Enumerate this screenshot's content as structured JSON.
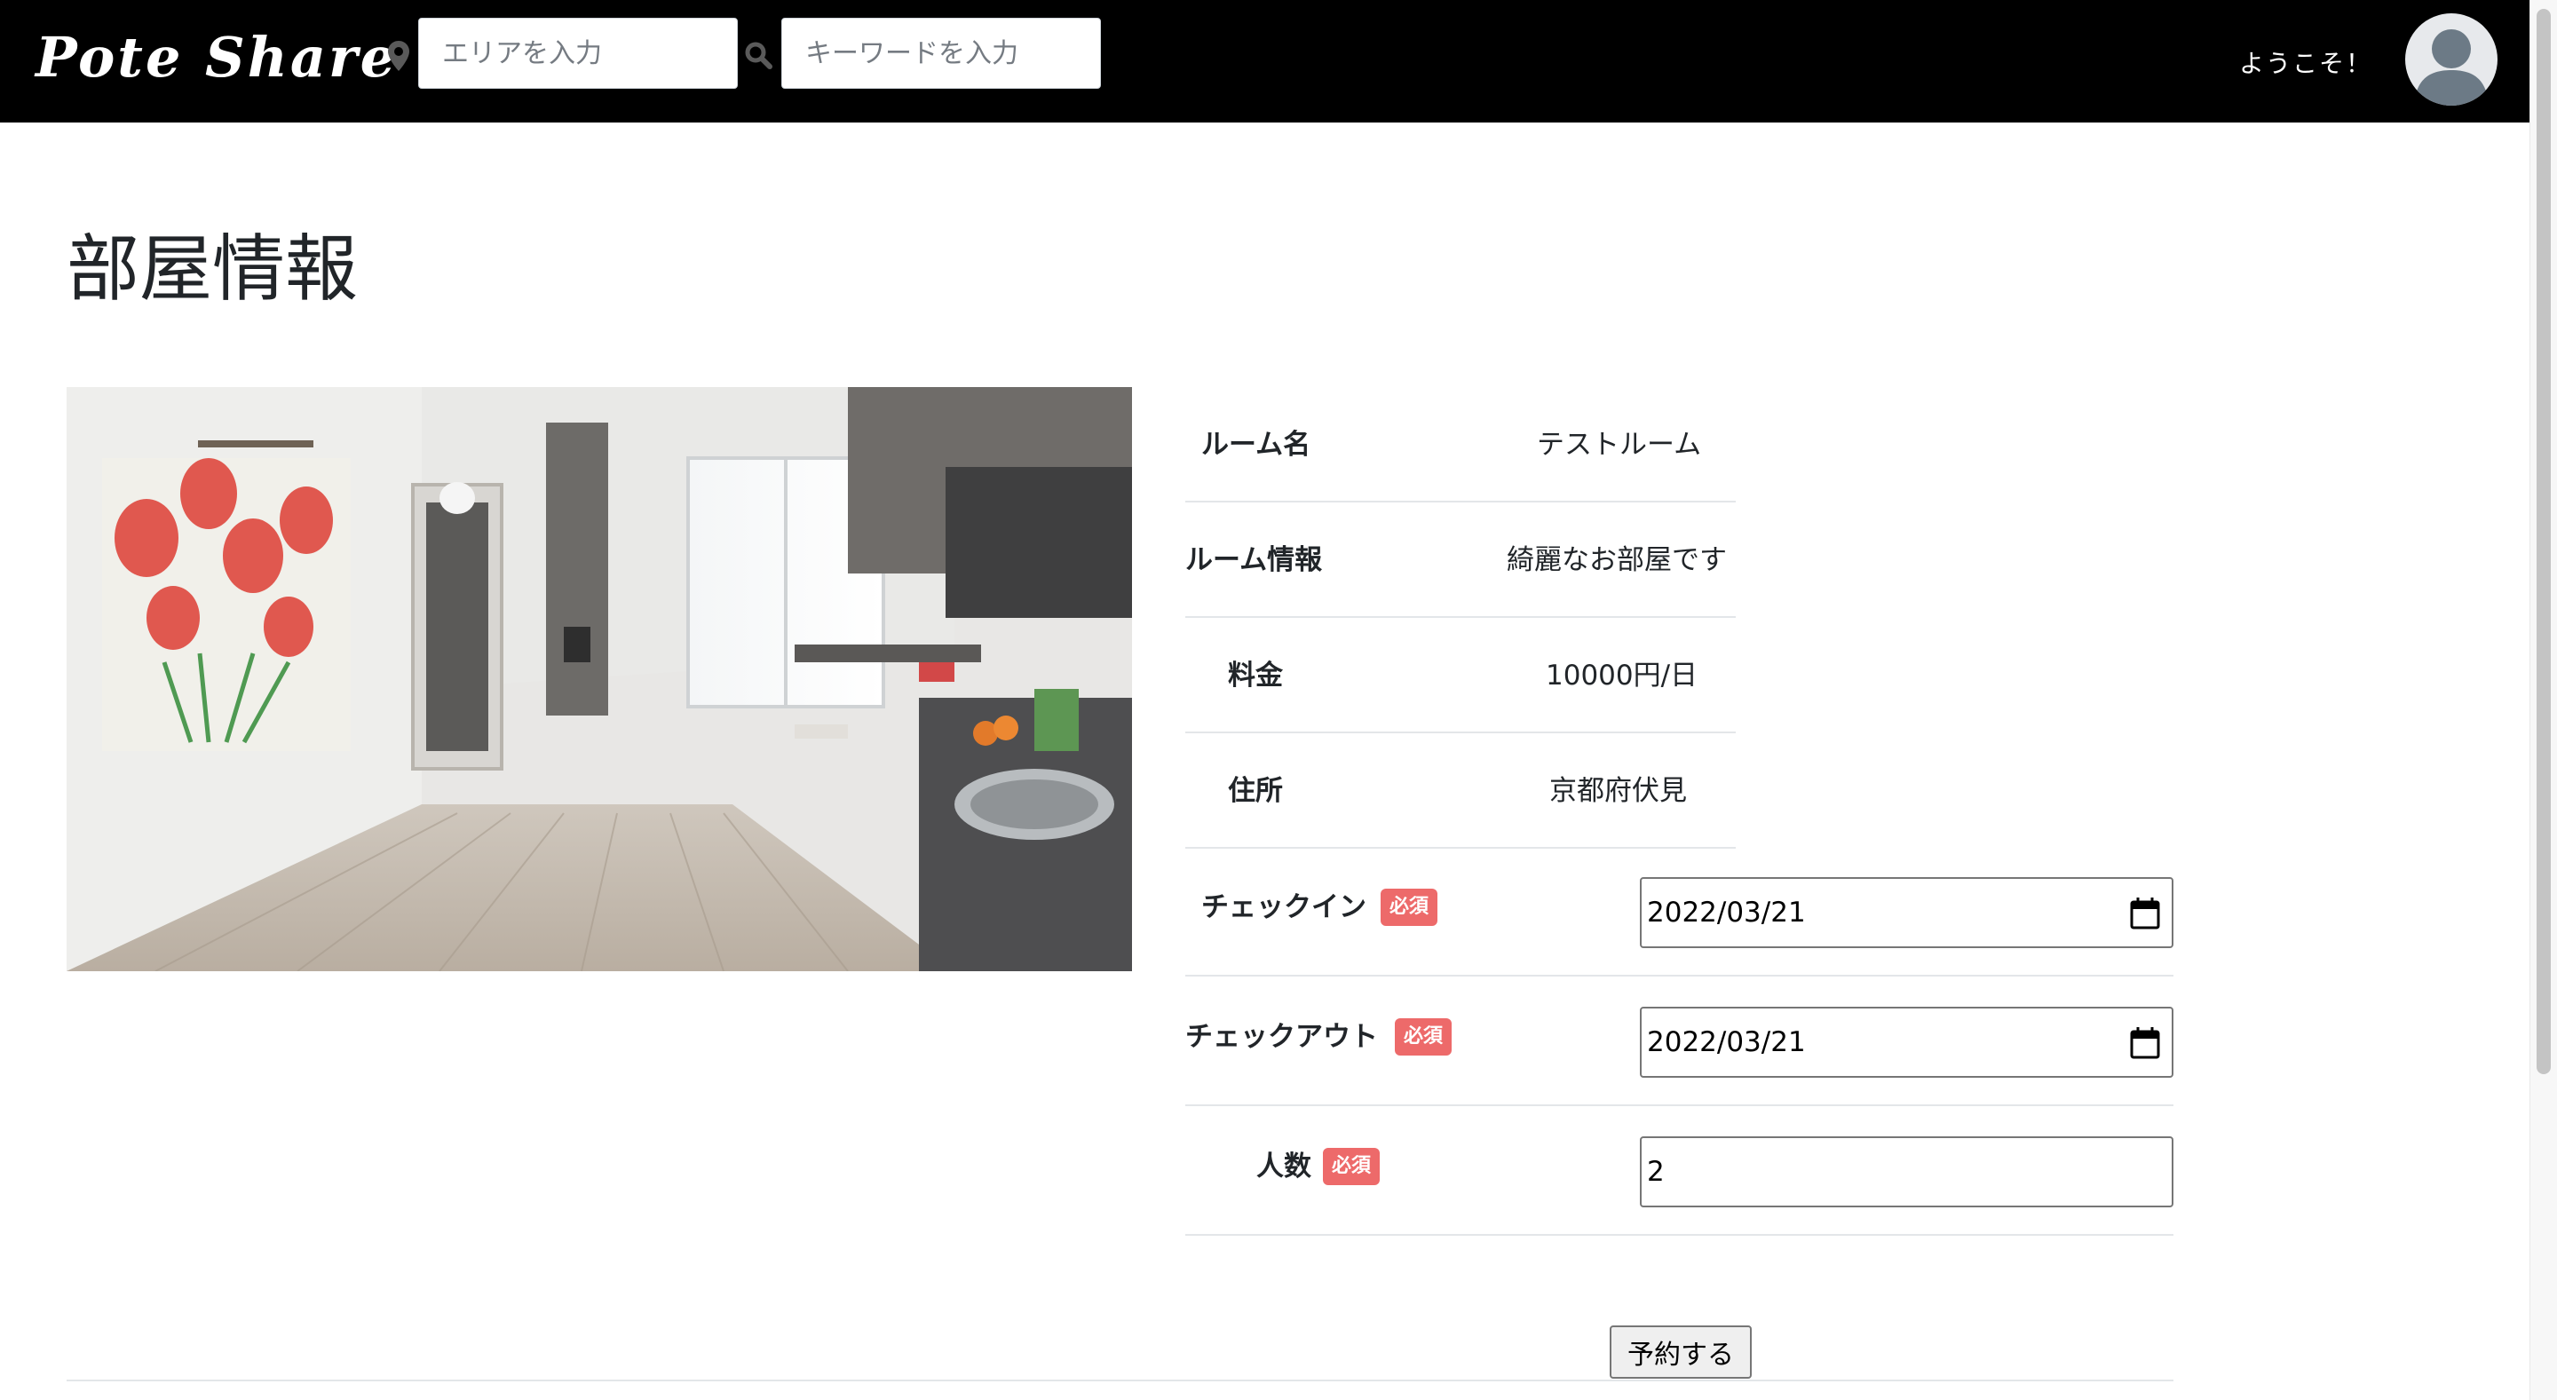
{
  "navbar": {
    "logo": "Pote Share",
    "area_placeholder": "エリアを入力",
    "keyword_placeholder": "キーワードを入力",
    "welcome": "ようこそ！",
    "icons": [
      "map-pin-icon",
      "search-icon",
      "user-avatar-icon"
    ]
  },
  "page": {
    "title": "部屋情報"
  },
  "room": {
    "name_label": "ルーム名",
    "name_value": "テストルーム",
    "info_label": "ルーム情報",
    "info_value": "綺麗なお部屋です",
    "price_label": "料金",
    "price_value": "10000円/日",
    "address_label": "住所",
    "address_value": "京都府伏見"
  },
  "form": {
    "required_badge": "必須",
    "checkin_label": "チェックイン",
    "checkin_value": "2022/03/21",
    "checkout_label": "チェックアウト",
    "checkout_value": "2022/03/21",
    "people_label": "人数",
    "people_value": "2",
    "submit_label": "予約する"
  },
  "colors": {
    "navbar_bg": "#000000",
    "required_badge": "#ed6a6a",
    "text": "#212529",
    "divider": "#e3e6e9"
  }
}
